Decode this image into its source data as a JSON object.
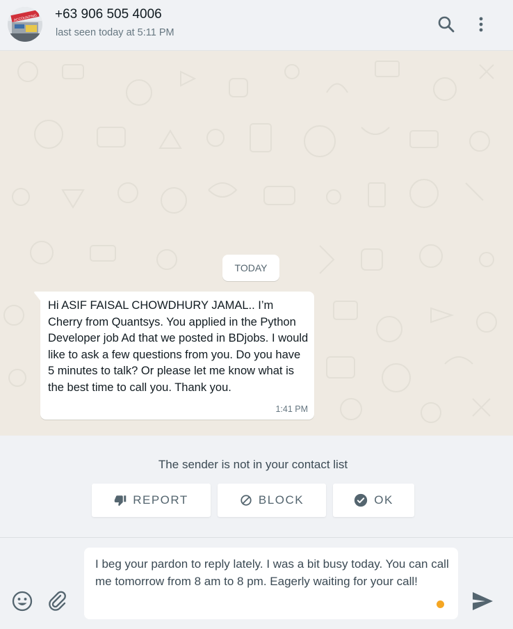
{
  "header": {
    "contact_name": "+63 906 505 4006",
    "status": "last seen today at 5:11 PM",
    "avatar_badge_text": "ACCOUNTING",
    "search_icon": "search-icon",
    "menu_icon": "more-vert-icon"
  },
  "chat": {
    "date_label": "TODAY",
    "messages": [
      {
        "text": "Hi ASIF FAISAL CHOWDHURY JAMAL.. I’m Cherry from Quantsys. You applied in the Python Developer job Ad that we posted in BDjobs. I would like to ask a few questions from you. Do you have 5 minutes to talk? Or please let me know what is the best time to call you. Thank you.",
        "time": "1:41 PM",
        "direction": "incoming"
      }
    ]
  },
  "notice": {
    "text": "The sender is not in your contact list",
    "report_label": "REPORT",
    "block_label": "BLOCK",
    "ok_label": "OK",
    "report_icon": "thumbs-down-icon",
    "block_icon": "block-icon",
    "ok_icon": "check-circle-icon"
  },
  "composer": {
    "value": "I beg your pardon to reply lately. I was a bit busy today. You can call me tomorrow from 8 am to 8 pm. Eagerly waiting for your call!",
    "emoji_icon": "emoji-icon",
    "attach_icon": "paperclip-icon",
    "send_icon": "send-icon",
    "typing_indicator_color": "#f5a623"
  },
  "colors": {
    "header_bg": "#f0f2f5",
    "chat_bg": "#efeae2",
    "bubble_bg": "#ffffff",
    "icon_gray": "#54656f"
  }
}
